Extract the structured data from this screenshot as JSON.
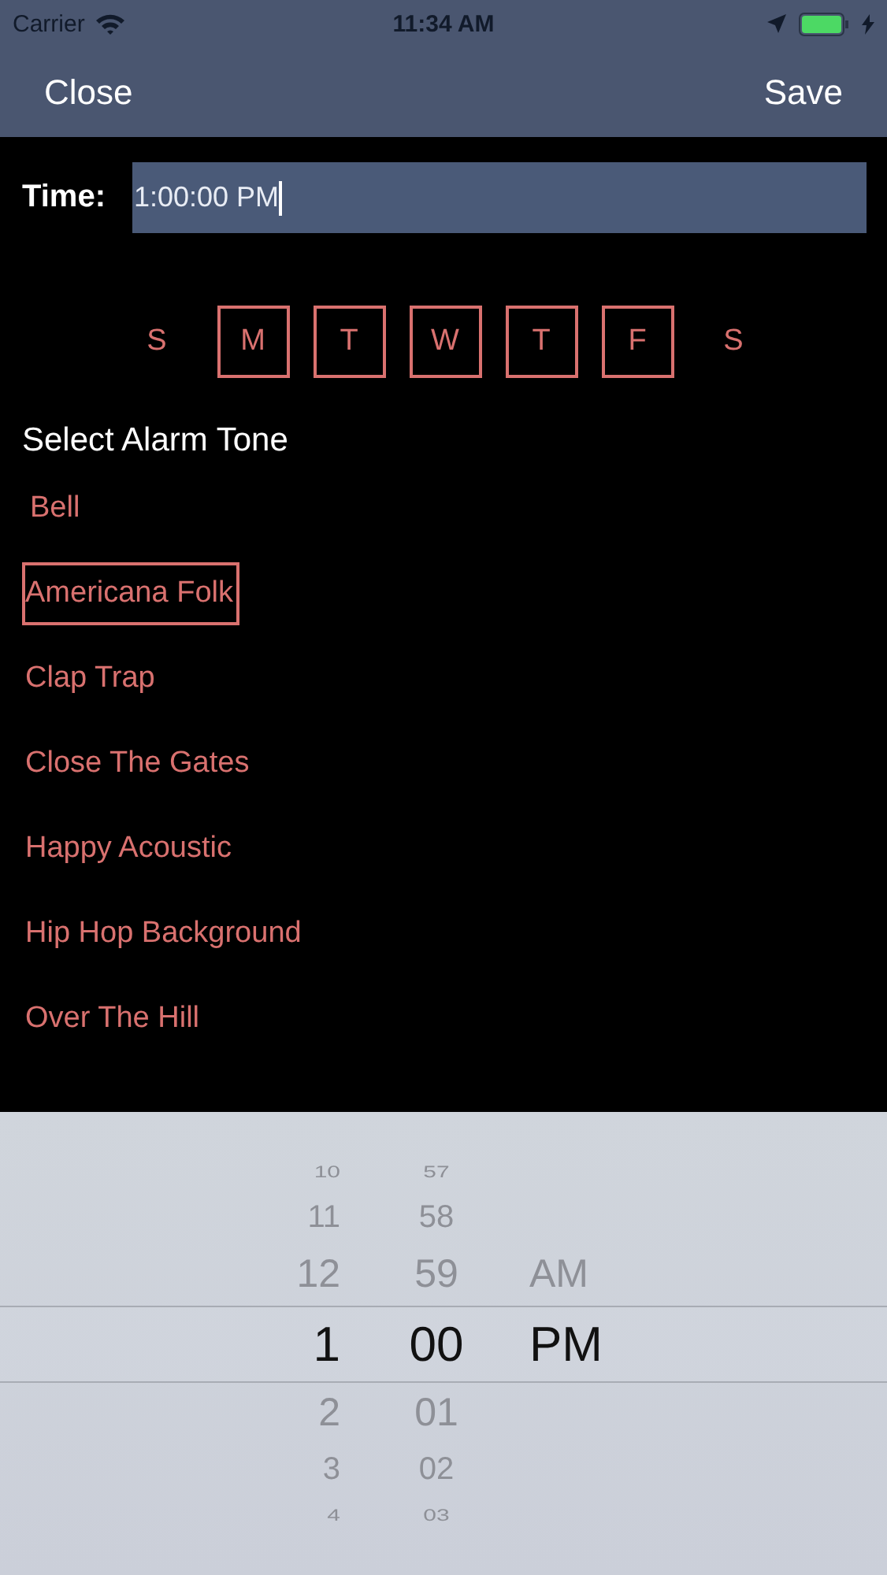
{
  "status_bar": {
    "carrier": "Carrier",
    "time": "11:34 AM"
  },
  "nav": {
    "left": "Close",
    "right": "Save"
  },
  "time_field": {
    "label": "Time:",
    "value": "1:00:00 PM"
  },
  "days": [
    {
      "label": "S",
      "selected": false
    },
    {
      "label": "M",
      "selected": true
    },
    {
      "label": "T",
      "selected": true
    },
    {
      "label": "W",
      "selected": true
    },
    {
      "label": "T",
      "selected": true
    },
    {
      "label": "F",
      "selected": true
    },
    {
      "label": "S",
      "selected": false
    }
  ],
  "tone_header": "Select Alarm Tone",
  "tones": [
    {
      "label": "Bell",
      "selected": false
    },
    {
      "label": "Americana Folk",
      "selected": true
    },
    {
      "label": "Clap Trap",
      "selected": false
    },
    {
      "label": "Close The Gates",
      "selected": false
    },
    {
      "label": "Happy Acoustic",
      "selected": false
    },
    {
      "label": "Hip Hop Background",
      "selected": false
    },
    {
      "label": "Over The Hill",
      "selected": false
    }
  ],
  "picker": {
    "columns": [
      {
        "items": [
          {
            "label": "10",
            "selected": false
          },
          {
            "label": "11",
            "selected": false
          },
          {
            "label": "12",
            "selected": false
          },
          {
            "label": "1",
            "selected": true
          },
          {
            "label": "2",
            "selected": false
          },
          {
            "label": "3",
            "selected": false
          },
          {
            "label": "4",
            "selected": false
          }
        ]
      },
      {
        "items": [
          {
            "label": "57",
            "selected": false
          },
          {
            "label": "58",
            "selected": false
          },
          {
            "label": "59",
            "selected": false
          },
          {
            "label": "00",
            "selected": true
          },
          {
            "label": "01",
            "selected": false
          },
          {
            "label": "02",
            "selected": false
          },
          {
            "label": "03",
            "selected": false
          }
        ]
      },
      {
        "items": [
          {
            "label": "AM",
            "selected": false
          },
          {
            "label": "PM",
            "selected": true
          }
        ]
      }
    ]
  }
}
